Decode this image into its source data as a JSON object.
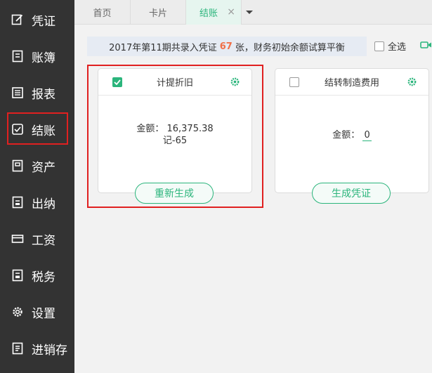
{
  "sidebar": {
    "items": [
      {
        "label": "凭证",
        "icon": "edit-icon"
      },
      {
        "label": "账簿",
        "icon": "ledger-icon"
      },
      {
        "label": "报表",
        "icon": "report-icon"
      },
      {
        "label": "结账",
        "icon": "checkout-icon"
      },
      {
        "label": "资产",
        "icon": "asset-icon"
      },
      {
        "label": "出纳",
        "icon": "cashier-icon"
      },
      {
        "label": "工资",
        "icon": "salary-icon"
      },
      {
        "label": "税务",
        "icon": "tax-icon"
      },
      {
        "label": "设置",
        "icon": "gear-icon"
      },
      {
        "label": "进销存",
        "icon": "inventory-icon"
      }
    ],
    "active_index": 3
  },
  "tabs": [
    {
      "label": "首页"
    },
    {
      "label": "卡片"
    },
    {
      "label": "结账",
      "close": "×"
    }
  ],
  "info": {
    "prefix": "2017年第11期共录入凭证",
    "count": "67",
    "suffix": "张，财务初始余额试算平衡"
  },
  "select_all": {
    "label": "全选"
  },
  "cards": [
    {
      "title": "计提折旧",
      "checked": true,
      "amount_label": "金额：",
      "amount_value": "16,375.38",
      "voucher": "记-65",
      "button": "重新生成"
    },
    {
      "title": "结转制造费用",
      "checked": false,
      "amount_label": "金额：",
      "amount_value": "0",
      "button": "生成凭证"
    }
  ],
  "colors": {
    "sidebar_bg": "#333333",
    "accent": "#2bb57c",
    "highlight": "#e02020",
    "count": "#f07048"
  }
}
